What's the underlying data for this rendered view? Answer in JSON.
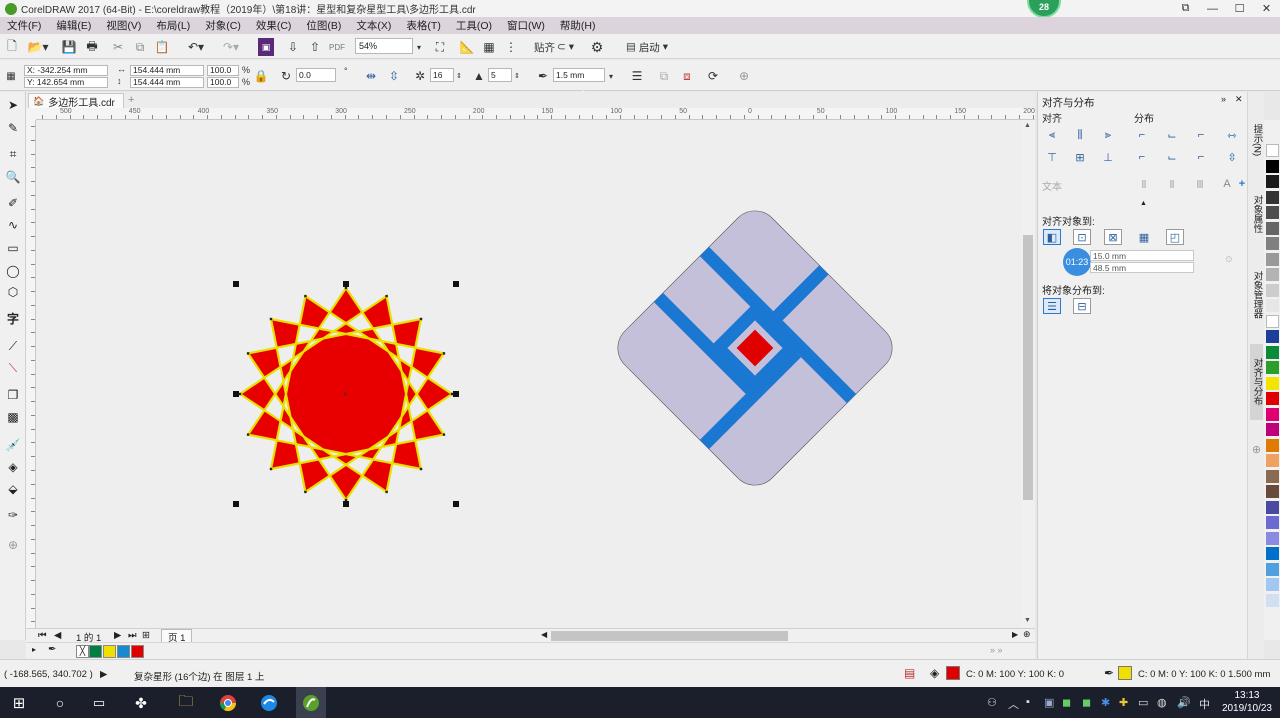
{
  "window": {
    "title": "CorelDRAW 2017 (64-Bit) - E:\\coreldraw教程（2019年）\\第18讲：星型和复杂星型工具\\多边形工具.cdr",
    "badge": "28",
    "controls": {
      "minimize": "—",
      "maximize": "☐",
      "close": "✕",
      "ribbon": "⧉"
    }
  },
  "menu": [
    "文件(F)",
    "编辑(E)",
    "视图(V)",
    "布局(L)",
    "对象(C)",
    "效果(C)",
    "位图(B)",
    "文本(X)",
    "表格(T)",
    "工具(O)",
    "窗口(W)",
    "帮助(H)"
  ],
  "standard_toolbar": {
    "zoom": "54%",
    "snap_label": "贴齐",
    "launch_label": "启动"
  },
  "property_bar": {
    "x": "X: -342.254 mm",
    "y": "Y: 142.654 mm",
    "width": "154.444 mm",
    "height": "154.444 mm",
    "scale_x": "100.0",
    "scale_y": "100.0",
    "percent": "%",
    "rotation": "0.0",
    "degree": "°",
    "points": "16",
    "sharpness": "5",
    "outline_width": "1.5 mm"
  },
  "document": {
    "tab_name": "多边形工具.cdr",
    "add_tab": "+"
  },
  "ruler": {
    "h_labels": [
      "500",
      "450",
      "400",
      "350",
      "300",
      "250",
      "200",
      "150",
      "100",
      "50",
      "0",
      "50",
      "100",
      "150",
      "200",
      "250"
    ]
  },
  "page_nav": {
    "position": "1 的 1",
    "page_tab": "页 1"
  },
  "status": {
    "coords": "( -168.565, 340.702 )",
    "object_info": "复杂星形 (16个边) 在 图层 1 上",
    "fill_info": "C: 0 M: 100 Y: 100 K: 0",
    "outline_info": "C: 0 M: 0 Y: 100 K: 0  1.500 mm",
    "fill_color": "#e00000",
    "outline_color": "#f0e000"
  },
  "docker": {
    "title": "对齐与分布",
    "align_label": "对齐",
    "distribute_label": "分布",
    "text_label": "文本",
    "align_to_label": "对齐对象到:",
    "distribute_to_label": "将对象分布到:",
    "field1": "15.0 mm",
    "field2": "48.5 mm",
    "timer": "01:23"
  },
  "side_tabs": [
    "提示(N)",
    "对象属性",
    "对象管理器",
    "对齐与分布"
  ],
  "palette_colors": [
    "#ffffff",
    "#000000",
    "#1a1a1a",
    "#333333",
    "#4d4d4d",
    "#666666",
    "#808080",
    "#999999",
    "#b3b3b3",
    "#cccccc",
    "#e6e6e6",
    "#ffffff",
    "#1d3f9a",
    "#0b8a3a",
    "#2aa02a",
    "#f2e600",
    "#e00000",
    "#e0006f",
    "#c0007a",
    "#e07a00",
    "#f0a060",
    "#8a6a50",
    "#6a4a3a",
    "#4a4aa0",
    "#6a6ad0",
    "#8a8ae0",
    "#0070c8",
    "#50a0e0",
    "#a0c8f0",
    "#d0e0f0"
  ],
  "doc_palette": [
    "#008040",
    "#f0e000",
    "#1a8ad0",
    "#e00000"
  ],
  "taskbar": {
    "time": "13:13",
    "date": "2019/10/23",
    "ime": "中"
  },
  "artwork": {
    "star_fill": "#e80000",
    "star_outline": "#e8e000",
    "diamond_fill": "#c4c0da",
    "diamond_stripe": "#1a78d2",
    "center_square": "#e00000"
  }
}
